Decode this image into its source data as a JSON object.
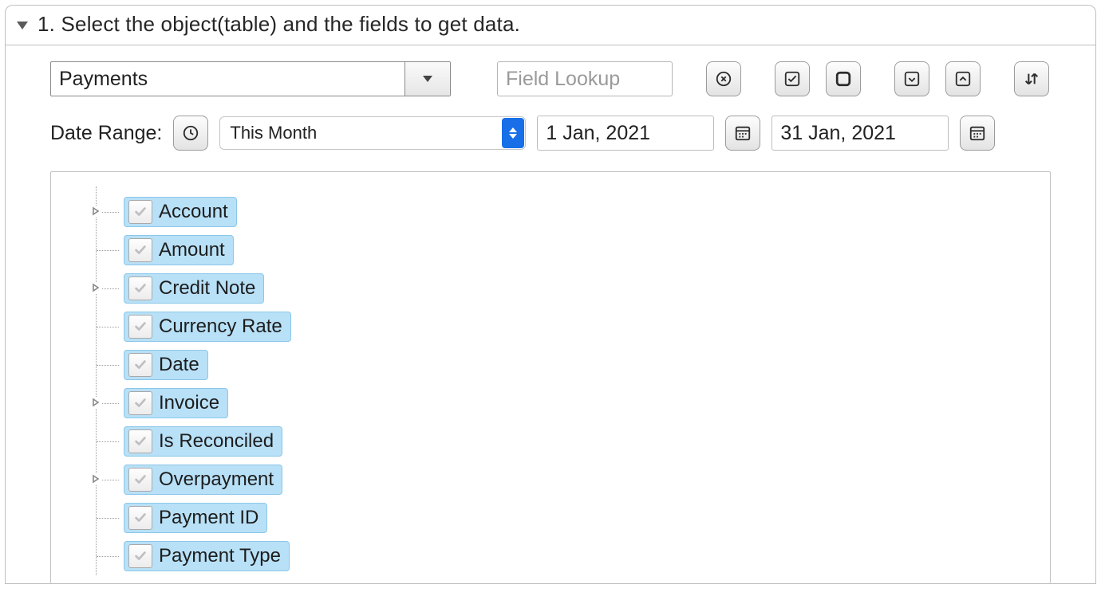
{
  "panel": {
    "title": "1. Select the object(table) and the fields to get data."
  },
  "object_combo": {
    "value": "Payments"
  },
  "field_lookup": {
    "placeholder": "Field Lookup"
  },
  "toolbar_icons": {
    "clear": "clear-icon",
    "check_all": "check-all-icon",
    "uncheck_all": "uncheck-all-icon",
    "expand_all": "expand-all-icon",
    "collapse_all": "collapse-all-icon",
    "sort": "sort-icon"
  },
  "date_range": {
    "label": "Date Range:",
    "preset": "This Month",
    "from": "1 Jan, 2021",
    "to": "31 Jan, 2021"
  },
  "fields": [
    {
      "label": "Account",
      "checked": true,
      "expandable": true
    },
    {
      "label": "Amount",
      "checked": true,
      "expandable": false
    },
    {
      "label": "Credit Note",
      "checked": true,
      "expandable": true
    },
    {
      "label": "Currency Rate",
      "checked": true,
      "expandable": false
    },
    {
      "label": "Date",
      "checked": true,
      "expandable": false
    },
    {
      "label": "Invoice",
      "checked": true,
      "expandable": true
    },
    {
      "label": "Is Reconciled",
      "checked": true,
      "expandable": false
    },
    {
      "label": "Overpayment",
      "checked": true,
      "expandable": true
    },
    {
      "label": "Payment ID",
      "checked": true,
      "expandable": false
    },
    {
      "label": "Payment Type",
      "checked": true,
      "expandable": false
    }
  ]
}
